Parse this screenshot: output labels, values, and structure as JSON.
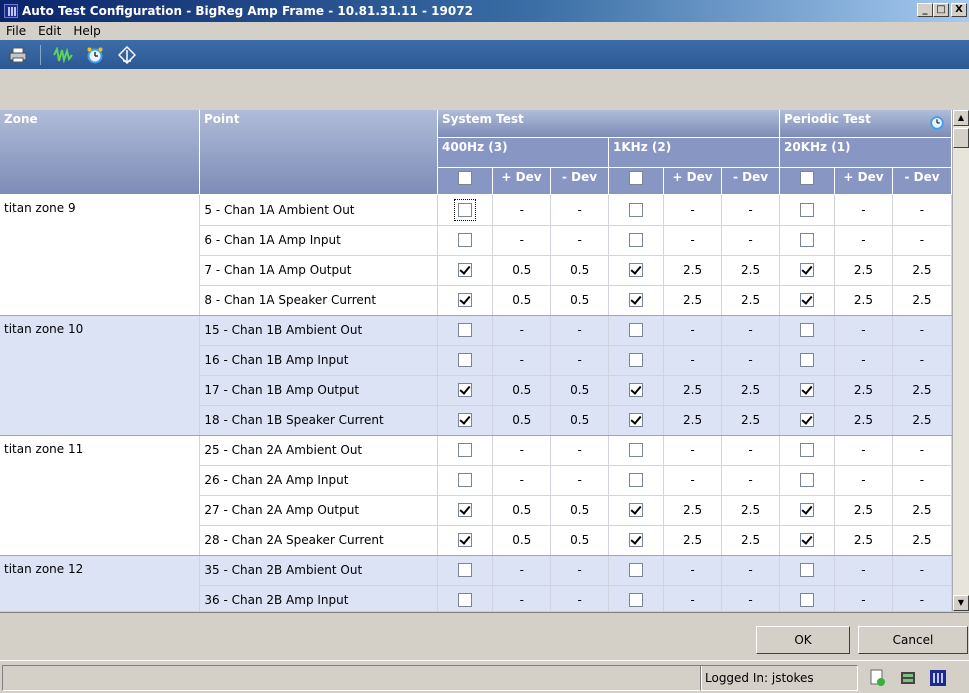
{
  "window": {
    "title": "Auto Test Configuration - BigReg Amp Frame - 10.81.31.11 - 19072",
    "minimize": "_",
    "maximize": "□",
    "close": "X"
  },
  "menu": [
    "File",
    "Edit",
    "Help"
  ],
  "toolbar": {
    "icons": [
      "printer-icon",
      "waveform-icon",
      "alarm-clock-icon",
      "signal-probe-icon"
    ]
  },
  "headers": {
    "zone": "Zone",
    "point": "Point",
    "system_test": "System Test",
    "periodic_test": "Periodic Test",
    "groups": [
      {
        "label": "400Hz (3)"
      },
      {
        "label": "1KHz (2)"
      },
      {
        "label": "20KHz (1)"
      }
    ],
    "plus_dev": "+ Dev",
    "minus_dev": "- Dev"
  },
  "rows": [
    {
      "zone": "titan zone 9",
      "point": "5 - Chan 1A Ambient Out",
      "v": [
        false,
        "-",
        "-",
        false,
        "-",
        "-",
        false,
        "-",
        "-"
      ]
    },
    {
      "zone": "",
      "point": "6 - Chan 1A Amp Input",
      "v": [
        false,
        "-",
        "-",
        false,
        "-",
        "-",
        false,
        "-",
        "-"
      ]
    },
    {
      "zone": "",
      "point": "7 - Chan 1A Amp Output",
      "v": [
        true,
        "0.5",
        "0.5",
        true,
        "2.5",
        "2.5",
        true,
        "2.5",
        "2.5"
      ]
    },
    {
      "zone": "",
      "point": "8 - Chan 1A Speaker Current",
      "v": [
        true,
        "0.5",
        "0.5",
        true,
        "2.5",
        "2.5",
        true,
        "2.5",
        "2.5"
      ]
    },
    {
      "zone": "titan zone 10",
      "point": "15 - Chan 1B Ambient Out",
      "v": [
        false,
        "-",
        "-",
        false,
        "-",
        "-",
        false,
        "-",
        "-"
      ]
    },
    {
      "zone": "",
      "point": "16 - Chan 1B Amp Input",
      "v": [
        false,
        "-",
        "-",
        false,
        "-",
        "-",
        false,
        "-",
        "-"
      ]
    },
    {
      "zone": "",
      "point": "17 - Chan 1B Amp Output",
      "v": [
        true,
        "0.5",
        "0.5",
        true,
        "2.5",
        "2.5",
        true,
        "2.5",
        "2.5"
      ]
    },
    {
      "zone": "",
      "point": "18 - Chan 1B Speaker Current",
      "v": [
        true,
        "0.5",
        "0.5",
        true,
        "2.5",
        "2.5",
        true,
        "2.5",
        "2.5"
      ]
    },
    {
      "zone": "titan zone 11",
      "point": "25 - Chan 2A Ambient Out",
      "v": [
        false,
        "-",
        "-",
        false,
        "-",
        "-",
        false,
        "-",
        "-"
      ]
    },
    {
      "zone": "",
      "point": "26 - Chan 2A Amp Input",
      "v": [
        false,
        "-",
        "-",
        false,
        "-",
        "-",
        false,
        "-",
        "-"
      ]
    },
    {
      "zone": "",
      "point": "27 - Chan 2A Amp Output",
      "v": [
        true,
        "0.5",
        "0.5",
        true,
        "2.5",
        "2.5",
        true,
        "2.5",
        "2.5"
      ]
    },
    {
      "zone": "",
      "point": "28 - Chan 2A Speaker Current",
      "v": [
        true,
        "0.5",
        "0.5",
        true,
        "2.5",
        "2.5",
        true,
        "2.5",
        "2.5"
      ]
    },
    {
      "zone": "titan zone 12",
      "point": "35 - Chan 2B Ambient Out",
      "v": [
        false,
        "-",
        "-",
        false,
        "-",
        "-",
        false,
        "-",
        "-"
      ]
    },
    {
      "zone": "",
      "point": "36 - Chan 2B Amp Input",
      "v": [
        false,
        "-",
        "-",
        false,
        "-",
        "-",
        false,
        "-",
        "-"
      ]
    }
  ],
  "buttons": {
    "ok": "OK",
    "cancel": "Cancel"
  },
  "status": {
    "logged_in_label": "Logged In:",
    "user": "jstokes"
  }
}
